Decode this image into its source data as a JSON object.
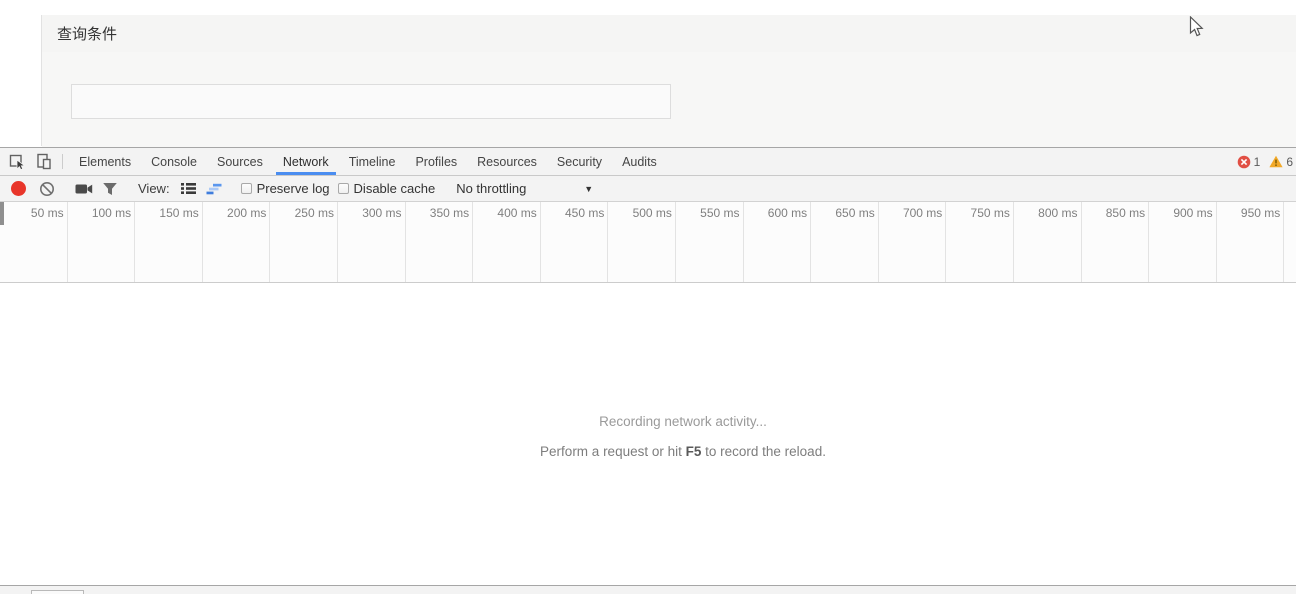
{
  "query_panel": {
    "title": "查询条件",
    "input_value": ""
  },
  "devtools": {
    "tabs": [
      {
        "label": "Elements"
      },
      {
        "label": "Console"
      },
      {
        "label": "Sources"
      },
      {
        "label": "Network"
      },
      {
        "label": "Timeline"
      },
      {
        "label": "Profiles"
      },
      {
        "label": "Resources"
      },
      {
        "label": "Security"
      },
      {
        "label": "Audits"
      }
    ],
    "active_tab": "Network",
    "badges": {
      "error_count": "1",
      "warning_count": "6"
    },
    "toolbar": {
      "view_label": "View:",
      "preserve_log": "Preserve log",
      "disable_cache": "Disable cache",
      "throttling": "No throttling"
    },
    "ruler_ticks": [
      "50 ms",
      "100 ms",
      "150 ms",
      "200 ms",
      "250 ms",
      "300 ms",
      "350 ms",
      "400 ms",
      "450 ms",
      "500 ms",
      "550 ms",
      "600 ms",
      "650 ms",
      "700 ms",
      "750 ms",
      "800 ms",
      "850 ms",
      "900 ms",
      "950 ms"
    ],
    "message": {
      "title": "Recording network activity...",
      "hint_prefix": "Perform a request or hit ",
      "hint_key": "F5",
      "hint_suffix": " to record the reload."
    }
  },
  "colors": {
    "accent_blue": "#4a8df0",
    "record_red": "#e8352a",
    "error_red": "#e14f44",
    "warning_yellow": "#f2a929"
  }
}
